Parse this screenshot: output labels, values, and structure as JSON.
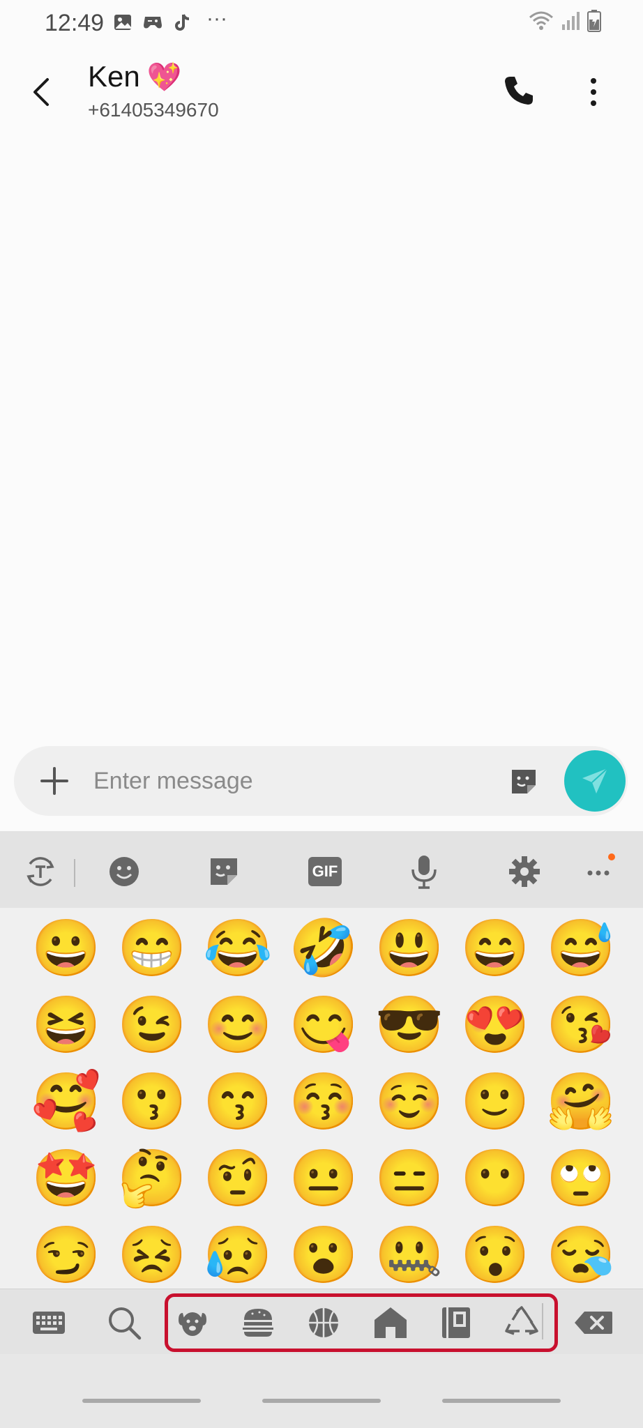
{
  "status_bar": {
    "time": "12:49",
    "more_dots": "···"
  },
  "header": {
    "contact_name": "Ken",
    "contact_emoji": "💖",
    "contact_number": "+61405349670"
  },
  "composer": {
    "placeholder": "Enter message"
  },
  "keyboard": {
    "toolbar": {
      "gif_label": "GIF"
    },
    "emoji_rows": [
      [
        "😀",
        "😁",
        "😂",
        "🤣",
        "😃",
        "😄",
        "😅"
      ],
      [
        "😆",
        "😉",
        "😊",
        "😋",
        "😎",
        "😍",
        "😘"
      ],
      [
        "🥰",
        "😗",
        "😙",
        "😚",
        "☺️",
        "🙂",
        "🤗"
      ],
      [
        "🤩",
        "🤔",
        "🤨",
        "😐",
        "😑",
        "😶",
        "🙄"
      ],
      [
        "😏",
        "😣",
        "😥",
        "😮",
        "🤐",
        "😯",
        "😪"
      ]
    ],
    "categories": [
      "dog",
      "burger",
      "basketball",
      "house",
      "book",
      "recycle"
    ]
  },
  "colors": {
    "send": "#21c1c1",
    "highlight": "#c8102e",
    "badge": "#ff6a1a"
  }
}
